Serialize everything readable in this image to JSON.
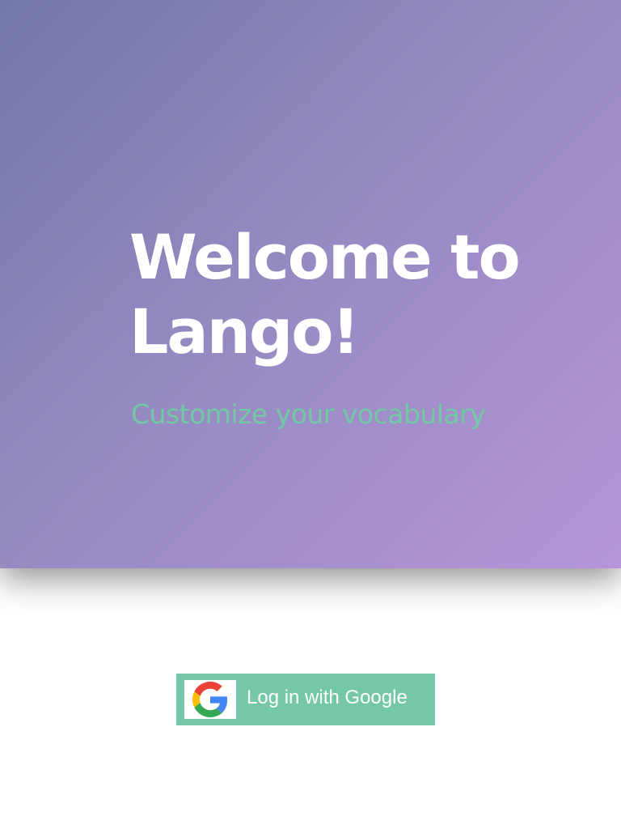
{
  "hero": {
    "title": "Welcome to Lango!",
    "subtitle": "Customize your vocabulary"
  },
  "login": {
    "button_label": "Log in with Google",
    "button_icon": "google-logo-icon"
  },
  "colors": {
    "gradient_start": "#7377ab",
    "gradient_end": "#b694da",
    "accent": "#74c8a7",
    "subtitle": "#72c9a4",
    "title": "#ffffff",
    "background": "#ffffff"
  }
}
